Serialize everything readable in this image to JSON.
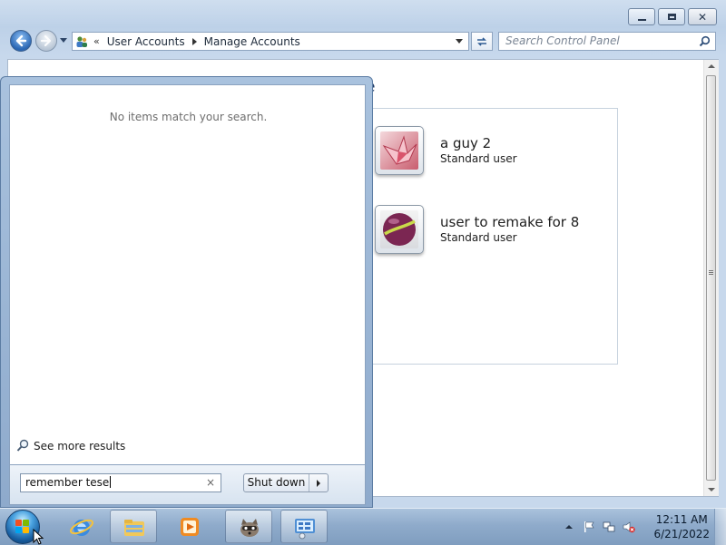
{
  "window": {
    "address": {
      "chevron": "«",
      "crumbs": [
        "User Accounts",
        "Manage Accounts"
      ]
    },
    "search_placeholder": "Search Control Panel",
    "caption_buttons": [
      "minimize-icon",
      "maximize-icon",
      "close-icon"
    ],
    "heading_fragment": "e"
  },
  "accounts": [
    {
      "name": "a guy 2",
      "type": "Standard user",
      "picture": "origami-crane"
    },
    {
      "name": "user to remake for 8",
      "type": "Standard user",
      "picture": "billiard-ball"
    }
  ],
  "start_menu": {
    "no_results": "No items match your search.",
    "see_more": "See more results",
    "search_value": "remember tese",
    "clear_glyph": "×",
    "shutdown_label": "Shut down"
  },
  "taskbar": {
    "pinned": [
      "explorer-icon",
      "internet-explorer-icon",
      "file-explorer-icon",
      "media-player-icon",
      "raccoon-app-icon",
      "control-panel-icon"
    ],
    "tray_icons": [
      "show-hidden-icons",
      "action-center-flag-icon",
      "network-icon",
      "volume-muted-icon"
    ],
    "time": "12:11 AM",
    "date": "6/21/2022"
  },
  "colors": {
    "taskbar": "#8fabcb",
    "window_frame": "#bdd1e8",
    "link_blue": "#1e3a66"
  }
}
